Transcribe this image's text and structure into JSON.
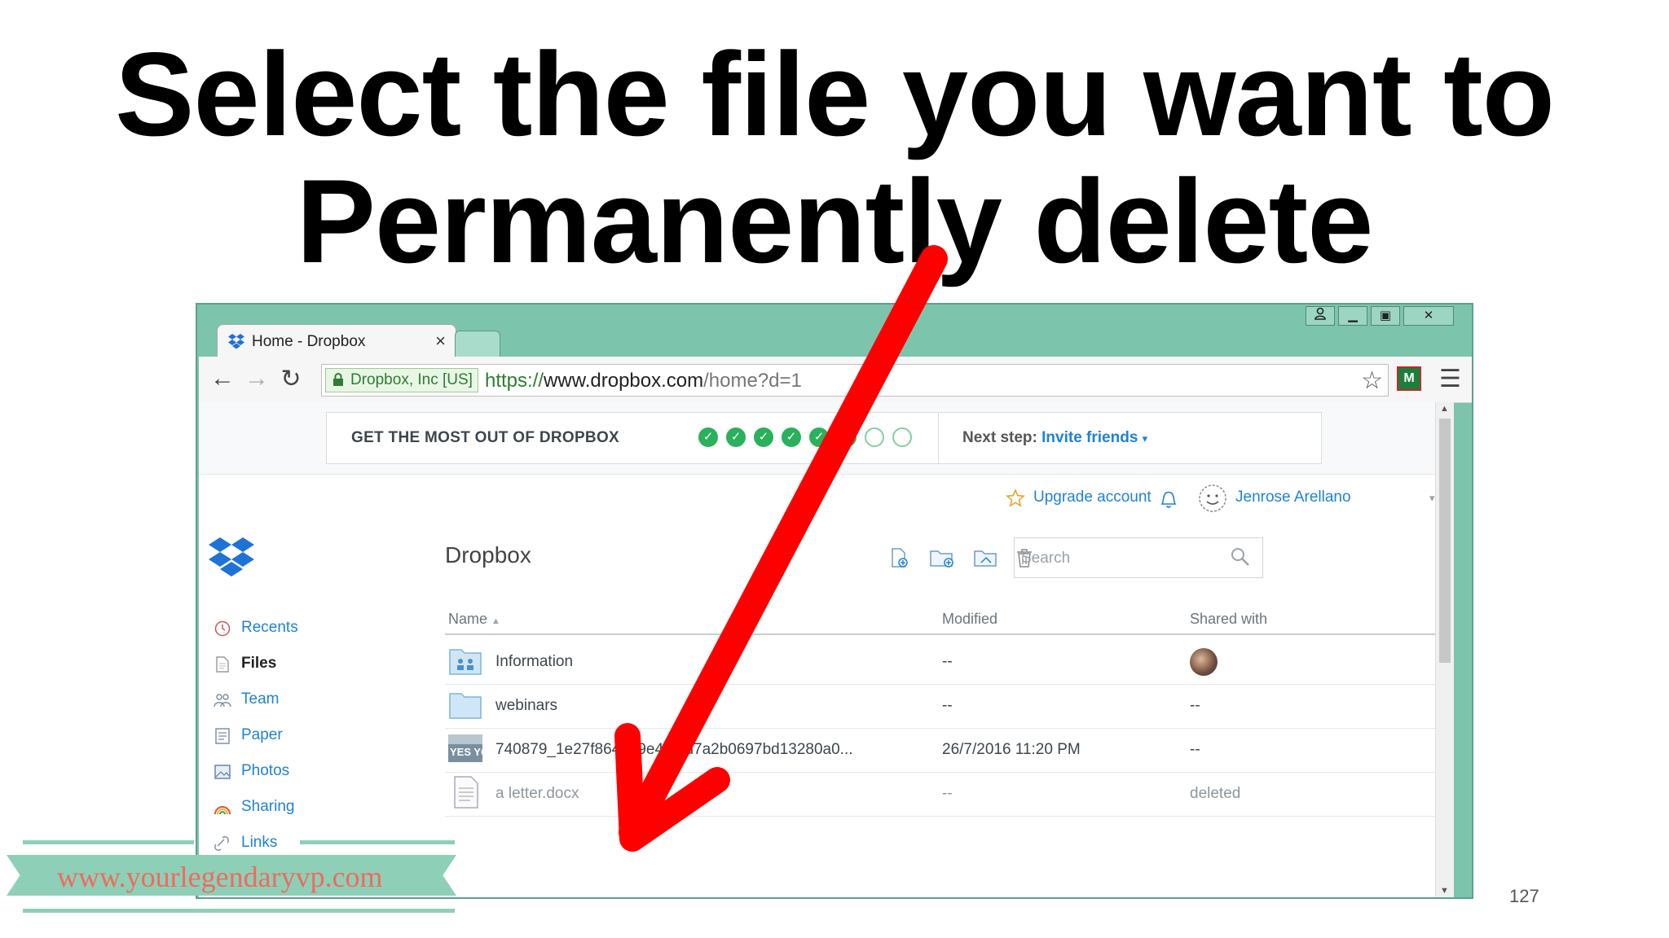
{
  "slide": {
    "title_line1": "Select the file you want to",
    "title_line2": "Permanently delete",
    "website": "www.yourlegendaryvp.com",
    "page_number": "127"
  },
  "browser": {
    "tab_title": "Home - Dropbox",
    "tab_close": "×",
    "window_controls": [
      "person-icon",
      "minimize-icon",
      "maximize-icon",
      "close-icon"
    ],
    "secure_label": "Dropbox, Inc [US]",
    "url_scheme": "https://",
    "url_host": "www.dropbox.com",
    "url_path": "/home?d=1"
  },
  "banner": {
    "label": "GET THE MOST OUT OF DROPBOX",
    "steps_done": 6,
    "steps_total": 8,
    "next_step_prefix": "Next step:",
    "next_step_link": "Invite friends",
    "next_step_caret": "▾"
  },
  "topbar": {
    "upgrade": "Upgrade account",
    "user_name": "Jenrose Arellano",
    "user_caret": "▾"
  },
  "sidebar": {
    "items": [
      {
        "label": "Recents",
        "icon": "clock-icon"
      },
      {
        "label": "Files",
        "icon": "file-icon"
      },
      {
        "label": "Team",
        "icon": "team-icon"
      },
      {
        "label": "Paper",
        "icon": "paper-icon"
      },
      {
        "label": "Photos",
        "icon": "photos-icon"
      },
      {
        "label": "Sharing",
        "icon": "sharing-icon"
      },
      {
        "label": "Links",
        "icon": "link-icon"
      }
    ]
  },
  "main": {
    "breadcrumb": "Dropbox",
    "search_placeholder": "Search",
    "columns": {
      "name": "Name",
      "name_sort": "▲",
      "modified": "Modified",
      "shared": "Shared with"
    },
    "rows": [
      {
        "name": "Information",
        "modified": "--",
        "shared": "",
        "type": "shared-folder"
      },
      {
        "name": "webinars",
        "modified": "--",
        "shared": "--",
        "type": "folder"
      },
      {
        "name": "740879_1e27f864ee9e42f2d7a2b0697bd13280a0...",
        "modified": "26/7/2016 11:20 PM",
        "shared": "--",
        "type": "image",
        "thumb_text": "YES YOU"
      },
      {
        "name": "a letter.docx",
        "modified": "--",
        "shared": "deleted",
        "type": "document"
      }
    ]
  },
  "colors": {
    "window_frame": "#7dc4ad",
    "link_blue": "#1f82d6",
    "arrow_red": "#ff0000",
    "check_green": "#2bb05b",
    "ribbon": "#8ed0b7",
    "ribbon_text": "#f06a5d"
  }
}
